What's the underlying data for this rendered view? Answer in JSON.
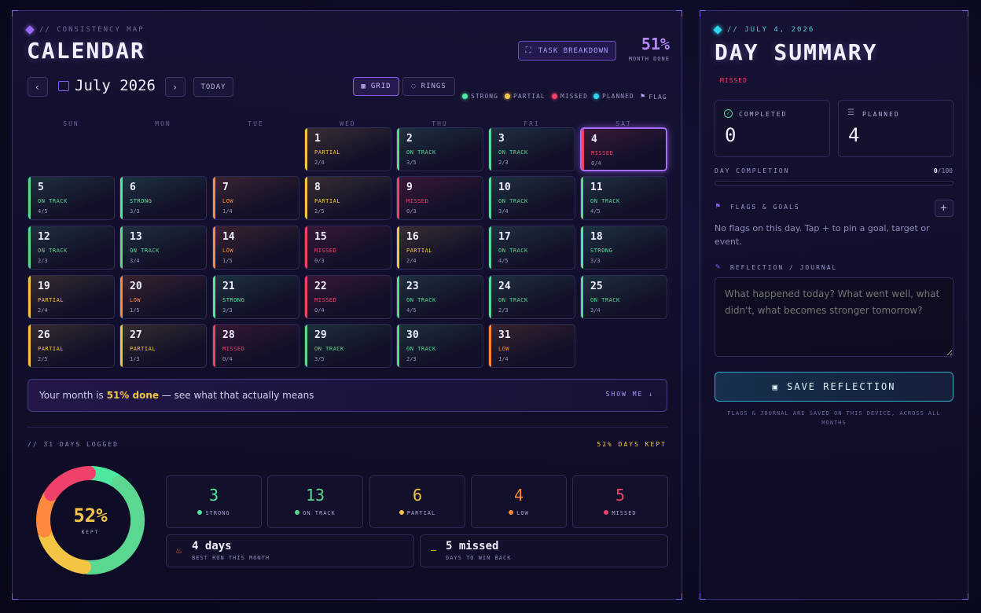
{
  "calendar": {
    "kicker": "// CONSISTENCY MAP",
    "title": "CALENDAR",
    "task_breakdown_label": "TASK BREAKDOWN",
    "month_done_pct": "51%",
    "month_done_label": "MONTH DONE",
    "month_label": "July 2026",
    "today_label": "TODAY",
    "view_grid_label": "GRID",
    "view_rings_label": "RINGS",
    "legend": [
      {
        "label": "STRONG",
        "color": "#4ee8a0"
      },
      {
        "label": "PARTIAL",
        "color": "#f4c545"
      },
      {
        "label": "MISSED",
        "color": "#f0416a"
      },
      {
        "label": "PLANNED",
        "color": "#2fd6f0"
      },
      {
        "label": "FLAG",
        "color": "#b7a7ff"
      }
    ],
    "weekdays": [
      "SUN",
      "MON",
      "TUE",
      "WED",
      "THU",
      "FRI",
      "SAT"
    ],
    "first_weekday": 3,
    "days": [
      {
        "day": "1",
        "status": "PARTIAL",
        "count": "2/4"
      },
      {
        "day": "2",
        "status": "ON TRACK",
        "count": "3/5"
      },
      {
        "day": "3",
        "status": "ON TRACK",
        "count": "2/3"
      },
      {
        "day": "4",
        "status": "MISSED",
        "count": "0/4",
        "selected": true
      },
      {
        "day": "5",
        "status": "ON TRACK",
        "count": "4/5"
      },
      {
        "day": "6",
        "status": "STRONG",
        "count": "3/3"
      },
      {
        "day": "7",
        "status": "LOW",
        "count": "1/4"
      },
      {
        "day": "8",
        "status": "PARTIAL",
        "count": "2/5"
      },
      {
        "day": "9",
        "status": "MISSED",
        "count": "0/3"
      },
      {
        "day": "10",
        "status": "ON TRACK",
        "count": "3/4"
      },
      {
        "day": "11",
        "status": "ON TRACK",
        "count": "4/5"
      },
      {
        "day": "12",
        "status": "ON TRACK",
        "count": "2/3"
      },
      {
        "day": "13",
        "status": "ON TRACK",
        "count": "3/4"
      },
      {
        "day": "14",
        "status": "LOW",
        "count": "1/5"
      },
      {
        "day": "15",
        "status": "MISSED",
        "count": "0/3"
      },
      {
        "day": "16",
        "status": "PARTIAL",
        "count": "2/4"
      },
      {
        "day": "17",
        "status": "ON TRACK",
        "count": "4/5"
      },
      {
        "day": "18",
        "status": "STRONG",
        "count": "3/3"
      },
      {
        "day": "19",
        "status": "PARTIAL",
        "count": "2/4"
      },
      {
        "day": "20",
        "status": "LOW",
        "count": "1/5"
      },
      {
        "day": "21",
        "status": "STRONG",
        "count": "3/3"
      },
      {
        "day": "22",
        "status": "MISSED",
        "count": "0/4"
      },
      {
        "day": "23",
        "status": "ON TRACK",
        "count": "4/5"
      },
      {
        "day": "24",
        "status": "ON TRACK",
        "count": "2/3"
      },
      {
        "day": "25",
        "status": "ON TRACK",
        "count": "3/4"
      },
      {
        "day": "26",
        "status": "PARTIAL",
        "count": "2/5"
      },
      {
        "day": "27",
        "status": "PARTIAL",
        "count": "1/3"
      },
      {
        "day": "28",
        "status": "MISSED",
        "count": "0/4"
      },
      {
        "day": "29",
        "status": "ON TRACK",
        "count": "3/5"
      },
      {
        "day": "30",
        "status": "ON TRACK",
        "count": "2/3"
      },
      {
        "day": "31",
        "status": "LOW",
        "count": "1/4"
      }
    ],
    "status_colors": {
      "STRONG": "#4ee8a0",
      "ON TRACK": "#5ad891",
      "PARTIAL": "#f4c545",
      "LOW": "#ff8a3d",
      "MISSED": "#f0416a"
    },
    "banner": {
      "prefix": "Your month is ",
      "highlight": "51% done",
      "suffix": " — see what that actually means",
      "action": "SHOW ME"
    },
    "summary": {
      "days_logged": "// 31 DAYS LOGGED",
      "days_kept": "52% DAYS KEPT",
      "ring_pct_text": "52%",
      "ring_label": "KEPT",
      "ring_segments": [
        {
          "label": "STRONG",
          "value": 3,
          "color": "#4ee8a0"
        },
        {
          "label": "ON TRACK",
          "value": 13,
          "color": "#5ad891"
        },
        {
          "label": "PARTIAL",
          "value": 6,
          "color": "#f4c545"
        },
        {
          "label": "LOW",
          "value": 4,
          "color": "#ff8a3d"
        },
        {
          "label": "MISSED",
          "value": 5,
          "color": "#f0416a"
        }
      ],
      "stats": [
        {
          "value": "3",
          "label": "STRONG",
          "color": "#4ee8a0"
        },
        {
          "value": "13",
          "label": "ON TRACK",
          "color": "#5ad891"
        },
        {
          "value": "6",
          "label": "PARTIAL",
          "color": "#f4c545"
        },
        {
          "value": "4",
          "label": "LOW",
          "color": "#ff8a3d"
        },
        {
          "value": "5",
          "label": "MISSED",
          "color": "#f0416a"
        }
      ],
      "best_run_value": "4 days",
      "best_run_label": "BEST RUN THIS MONTH",
      "missed_value": "5 missed",
      "missed_label": "DAYS TO WIN BACK"
    }
  },
  "day_summary": {
    "kicker": "// JULY 4, 2026",
    "title": "DAY SUMMARY",
    "status": "MISSED",
    "completed_label": "COMPLETED",
    "completed_value": "0",
    "planned_label": "PLANNED",
    "planned_value": "4",
    "completion_label": "DAY COMPLETION",
    "completion_value": "0",
    "completion_max": "/100",
    "flags_label": "FLAGS & GOALS",
    "flags_empty": "No flags on this day. Tap + to pin a goal, target or event.",
    "reflection_label": "REFLECTION / JOURNAL",
    "reflection_placeholder": "What happened today? What went well, what didn't, what becomes stronger tomorrow?",
    "save_label": "SAVE REFLECTION",
    "footnote": "FLAGS & JOURNAL ARE SAVED ON THIS DEVICE, ACROSS ALL MONTHS"
  }
}
